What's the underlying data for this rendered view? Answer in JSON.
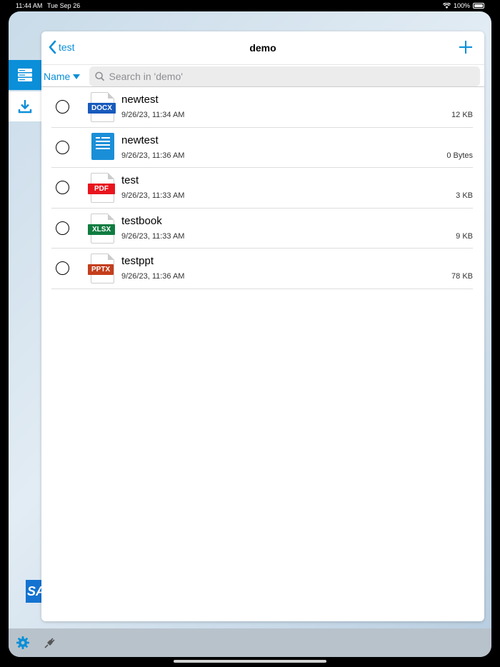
{
  "status_bar": {
    "time": "11:44 AM",
    "date": "Tue Sep 26",
    "battery": "100%"
  },
  "nav": {
    "back_label": "test",
    "title": "demo"
  },
  "search": {
    "sort_label": "Name",
    "placeholder": "Search in 'demo'"
  },
  "files": [
    {
      "name": "newtest",
      "date": "9/26/23, 11:34 AM",
      "size": "12 KB",
      "type": "DOCX"
    },
    {
      "name": "newtest",
      "date": "9/26/23, 11:36 AM",
      "size": "0 Bytes",
      "type": "TXT"
    },
    {
      "name": "test",
      "date": "9/26/23, 11:33 AM",
      "size": "3 KB",
      "type": "PDF"
    },
    {
      "name": "testbook",
      "date": "9/26/23, 11:33 AM",
      "size": "9 KB",
      "type": "XLSX"
    },
    {
      "name": "testppt",
      "date": "9/26/23, 11:36 AM",
      "size": "78 KB",
      "type": "PPTX"
    }
  ],
  "sidebar": {
    "logo_text": "SA"
  },
  "colors": {
    "accent": "#0a8fd8",
    "docx": "#185abd",
    "pdf": "#e8151d",
    "xlsx": "#107c41",
    "pptx": "#c43e1c"
  },
  "icons": {
    "storage": "server-stack-icon",
    "download": "download-icon",
    "settings": "gear-icon",
    "connection": "plug-icon",
    "back": "chevron-left-icon",
    "add": "plus-icon",
    "search": "magnifier-icon"
  }
}
